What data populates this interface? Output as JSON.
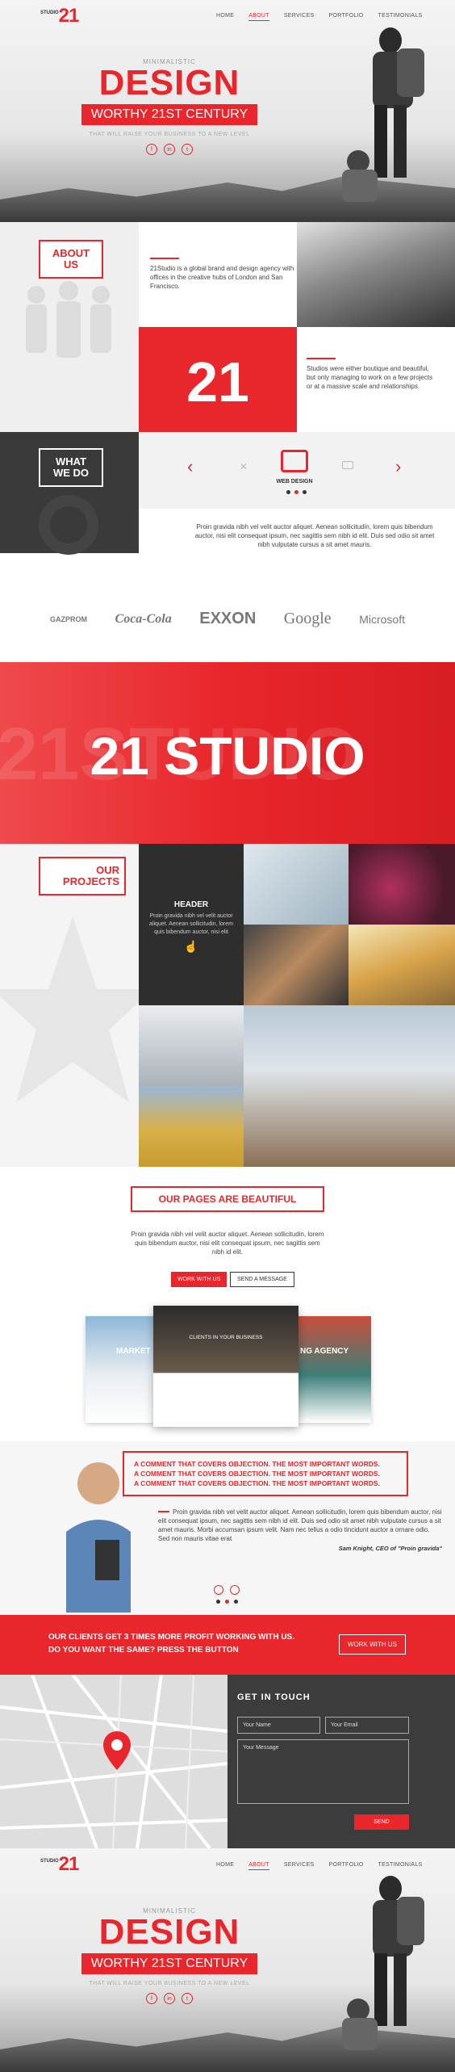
{
  "header": {
    "logo_small": "STUDIO",
    "logo_number": "21",
    "nav": [
      "HOME",
      "ABOUT",
      "SERVICES",
      "PORTFOLIO",
      "TESTIMONIALS"
    ],
    "active_nav": "ABOUT"
  },
  "hero": {
    "kicker": "MINIMALISTIC",
    "title": "DESIGN",
    "subtitle": "WORTHY 21ST CENTURY",
    "tagline": "THAT WILL RAISE YOUR BUSINESS TO A NEW LEVEL",
    "social": [
      "f",
      "in",
      "t"
    ]
  },
  "about": {
    "label": "ABOUT US",
    "label_line1": "ABOUT",
    "label_line2": "US",
    "text1": "21Studio is a global brand and design agency with offices in the creative hubs of London and San Francisco.",
    "number": "21",
    "text2": "Studios were either boutique and beautiful, but only managing to work on a few projects or at a massive scale and relationships."
  },
  "whatwedo": {
    "label_line1": "WHAT",
    "label_line2": "WE DO",
    "service": "WEB DESIGN",
    "text": "Proin gravida nibh vel velit auctor aliquet. Aenean sollicitudin, lorem quis bibendum auctor, nisi elit consequat ipsum, nec sagittis sem nibh id elit. Duis sed odio sit amet nibh vulputate cursus a sit amet mauris."
  },
  "clients": [
    "GAZPROM",
    "Coca-Cola",
    "EXXON",
    "Google",
    "Microsoft"
  ],
  "banner": {
    "title": "21 STUDIO",
    "bg_text": "21STUDIO"
  },
  "projects": {
    "label_line1": "OUR",
    "label_line2": "PROJECTS",
    "card_title": "HEADER",
    "card_text": "Proin gravida nibh vel velit auctor aliquet. Aenean sollicitudin, lorem quis bibendum auctor, nisi elit"
  },
  "pages": {
    "title": "OUR PAGES ARE BEAUTIFUL",
    "text": "Proin gravida nibh vel velit auctor aliquet. Aenean sollicitudin, lorem quis bibendum auctor, nisi elit consequat ipsum, nec sagittis sem nibh id elit.",
    "btn_primary": "WORK WITH US",
    "btn_secondary": "SEND A MESSAGE",
    "mock_center": "CLIENTS IN YOUR BUSINESS",
    "mock_left": "MARKET",
    "mock_right": "NG AGENCY"
  },
  "testimonial": {
    "lines": [
      "A COMMENT THAT COVERS OBJECTION. THE MOST IMPORTANT WORDS.",
      "A COMMENT THAT COVERS OBJECTION. THE MOST IMPORTANT WORDS.",
      "A COMMENT THAT COVERS OBJECTION. THE MOST IMPORTANT WORDS."
    ],
    "text": "Proin gravida nibh vel velit auctor aliquet. Aenean sollicitudin, lorem quis bibendum auctor, nisi elit consequat ipsum, nec sagittis sem nibh id elit. Duis sed odio sit amet nibh vulputate cursus a sit amet mauris. Morbi accumsan ipsum velit. Nam nec tellus a odio tincidunt auctor a ornare odio. Sed non mauris vitae erat",
    "author": "Sam Knight, CEO of \"Proin gravida\""
  },
  "cta": {
    "line1": "OUR CLIENTS GET 3 TIMES MORE PROFIT WORKING WITH US.",
    "line2": "DO YOU WANT THE SAME? PRESS THE BUTTON",
    "button": "WORK WITH US"
  },
  "contact": {
    "title": "GET IN TOUCH",
    "name_placeholder": "Your Name",
    "email_placeholder": "Your Email",
    "message_placeholder": "Your Message",
    "send": "SEND"
  },
  "colors": {
    "accent": "#e8262b",
    "dark": "#3a3a3a"
  }
}
